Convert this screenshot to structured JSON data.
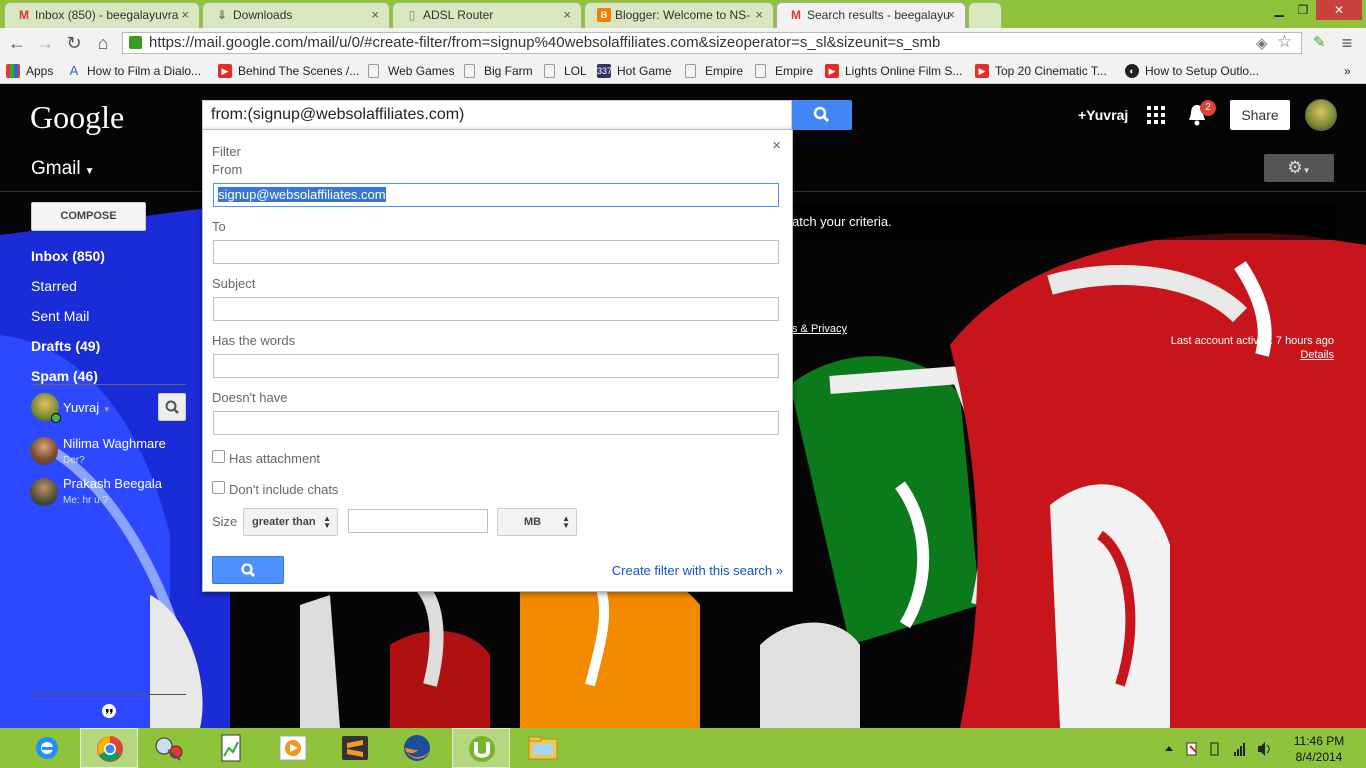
{
  "browser": {
    "tabs": [
      {
        "title": "Inbox (850) - beegalayuvra",
        "icon": "gmail-icon"
      },
      {
        "title": "Downloads",
        "icon": "download-icon"
      },
      {
        "title": "ADSL Router",
        "icon": "page-icon"
      },
      {
        "title": "Blogger: Welcome to NS-",
        "icon": "blogger-icon"
      },
      {
        "title": "Search results - beegalayu",
        "icon": "gmail-icon"
      }
    ],
    "url": "https://mail.google.com/mail/u/0/#create-filter/from=signup%40websolaffiliates.com&sizeoperator=s_sl&sizeunit=s_smb",
    "bookmarks": [
      "Apps",
      "How to Film a Dialo...",
      "Behind The Scenes /...",
      "Web Games",
      "Big Farm",
      "LOL",
      "Hot Game",
      "Empire",
      "Empire",
      "Lights Online Film S...",
      "Top 20 Cinematic T...",
      "How to Setup Outlo..."
    ],
    "bookmark_badge": "337"
  },
  "gmail": {
    "logo": "Google",
    "search_value": "from:(signup@websolaffiliates.com)",
    "user_link": "+Yuvraj",
    "notif_count": "2",
    "share_label": "Share",
    "app_label": "Gmail",
    "compose_label": "COMPOSE",
    "nav": [
      {
        "label": "Inbox (850)",
        "bold": true
      },
      {
        "label": "Starred",
        "bold": false
      },
      {
        "label": "Sent Mail",
        "bold": false
      },
      {
        "label": "Drafts (49)",
        "bold": true
      },
      {
        "label": "Spam (46)",
        "bold": true
      }
    ],
    "chat_user": "Yuvraj",
    "contacts": [
      {
        "name": "Nilima Waghmare",
        "status": "Der?"
      },
      {
        "name": "Prakash Beegala",
        "status": "Me: hr u ?"
      }
    ],
    "notice_text": "atch your criteria.",
    "terms_link": "s & Privacy",
    "activity_text": "Last account activity: 7 hours ago",
    "details_link": "Details"
  },
  "filter": {
    "title": "Filter",
    "from_label": "From",
    "from_value": "signup@websolaffiliates.com",
    "to_label": "To",
    "subject_label": "Subject",
    "has_words_label": "Has the words",
    "doesnt_have_label": "Doesn't have",
    "has_attachment_label": "Has attachment",
    "no_chats_label": "Don't include chats",
    "size_label": "Size",
    "size_operator": "greater than",
    "size_unit": "MB",
    "create_link": "Create filter with this search »"
  },
  "taskbar": {
    "time": "11:46 PM",
    "date": "8/4/2014"
  },
  "colors": {
    "chrome_green": "#8ec33b",
    "google_blue": "#4285f4",
    "link_blue": "#1155cc",
    "badge_red": "#db4437"
  }
}
